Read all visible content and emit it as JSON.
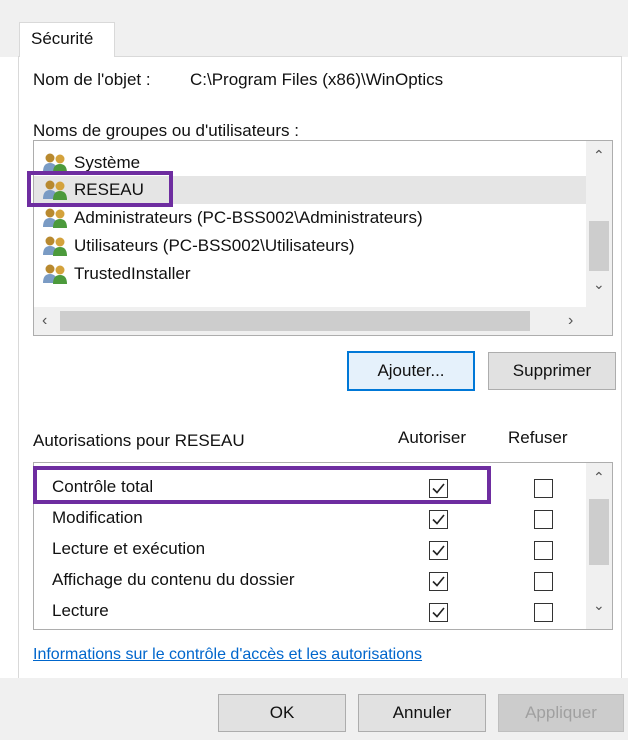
{
  "window": {
    "tab_label": "Sécurité"
  },
  "object": {
    "label": "Nom de l'objet :",
    "value": "C:\\Program Files (x86)\\WinOptics"
  },
  "groups": {
    "label": "Noms de groupes ou d'utilisateurs :",
    "items": [
      {
        "label": "Système"
      },
      {
        "label": "RESEAU"
      },
      {
        "label": "Administrateurs (PC-BSS002\\Administrateurs)"
      },
      {
        "label": "Utilisateurs (PC-BSS002\\Utilisateurs)"
      },
      {
        "label": "TrustedInstaller"
      }
    ],
    "selected": "RESEAU",
    "add_button": "Ajouter...",
    "remove_button": "Supprimer"
  },
  "permissions": {
    "label": "Autorisations pour RESEAU",
    "allow_header": "Autoriser",
    "deny_header": "Refuser",
    "rows": [
      {
        "label": "Contrôle total",
        "allow": true,
        "deny": false
      },
      {
        "label": "Modification",
        "allow": true,
        "deny": false
      },
      {
        "label": "Lecture et exécution",
        "allow": true,
        "deny": false
      },
      {
        "label": "Affichage du contenu du dossier",
        "allow": true,
        "deny": false
      },
      {
        "label": "Lecture",
        "allow": true,
        "deny": false
      }
    ]
  },
  "link_text": "Informations sur le contrôle d'accès et les autorisations",
  "footer": {
    "ok": "OK",
    "cancel": "Annuler",
    "apply": "Appliquer"
  },
  "colors": {
    "highlight": "#6e2da0",
    "link": "#0066cc",
    "selection": "#e5e5e5"
  }
}
